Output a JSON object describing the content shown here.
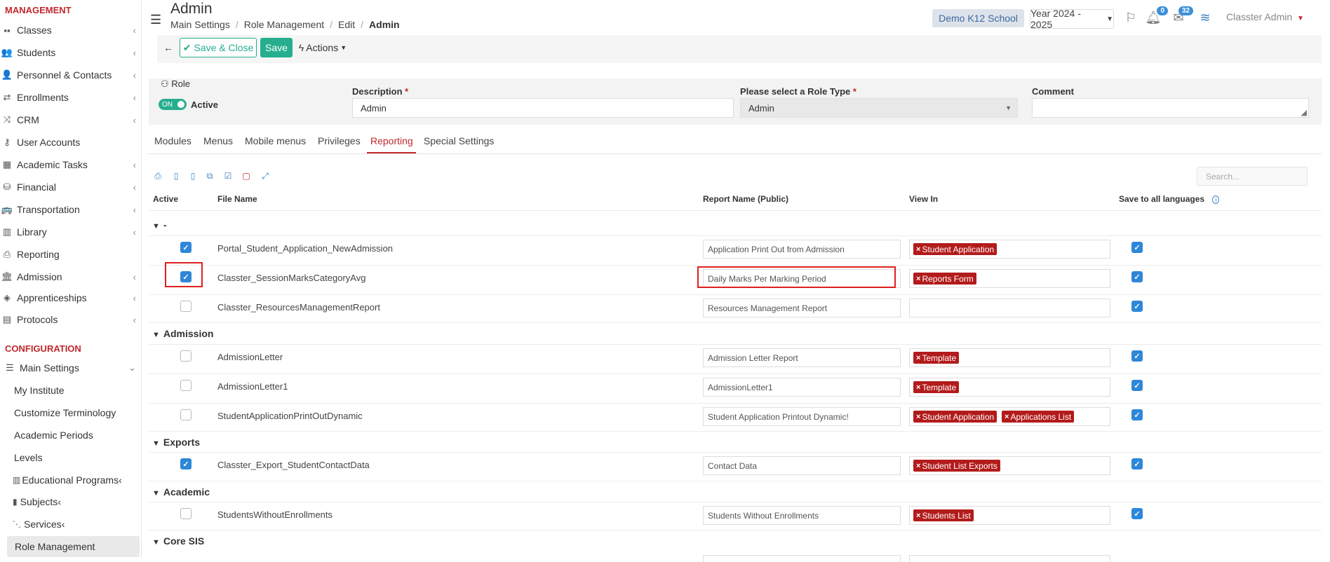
{
  "sidebar": {
    "management_title": "MANAGEMENT",
    "management_items": [
      {
        "label": "Classes",
        "icon": "classes-icon"
      },
      {
        "label": "Students",
        "icon": "students-icon"
      },
      {
        "label": "Personnel & Contacts",
        "icon": "person-icon"
      },
      {
        "label": "Enrollments",
        "icon": "swap-arrows-icon"
      },
      {
        "label": "CRM",
        "icon": "crm-icon"
      },
      {
        "label": "User Accounts",
        "icon": "key-icon"
      },
      {
        "label": "Academic Tasks",
        "icon": "grid-icon"
      },
      {
        "label": "Financial",
        "icon": "coins-icon"
      },
      {
        "label": "Transportation",
        "icon": "bus-icon"
      },
      {
        "label": "Library",
        "icon": "books-icon"
      },
      {
        "label": "Reporting",
        "icon": "printer-icon"
      },
      {
        "label": "Admission",
        "icon": "bank-icon"
      },
      {
        "label": "Apprenticeships",
        "icon": "box-icon"
      },
      {
        "label": "Protocols",
        "icon": "document-icon"
      }
    ],
    "configuration_title": "CONFIGURATION",
    "main_settings_label": "Main Settings",
    "sub_items": [
      "My Institute",
      "Customize Terminology",
      "Academic Periods",
      "Levels",
      "Educational Programs",
      "Subjects",
      "Services",
      "Role Management"
    ]
  },
  "header": {
    "title": "Admin",
    "breadcrumb": [
      "Main Settings",
      "Role Management",
      "Edit",
      "Admin"
    ],
    "school": "Demo K12 School",
    "year": "Year 2024 - 2025",
    "notifications_count": "0",
    "messages_count": "32",
    "user": "Classter Admin"
  },
  "toolbar": {
    "save_close": "Save & Close",
    "save": "Save",
    "actions": "Actions"
  },
  "role": {
    "section_label": "Role",
    "toggle_label": "ON",
    "active_label": "Active",
    "description_label": "Description",
    "description_value": "Admin",
    "role_type_label": "Please select a Role Type",
    "role_type_value": "Admin",
    "comment_label": "Comment",
    "comment_value": ""
  },
  "tabs": [
    "Modules",
    "Menus",
    "Mobile menus",
    "Privileges",
    "Reporting",
    "Special Settings"
  ],
  "grid": {
    "search_placeholder": "Search...",
    "headers": {
      "active": "Active",
      "file_name": "File Name",
      "report_name": "Report Name (Public)",
      "view_in": "View In",
      "save_all": "Save to all languages"
    },
    "groups": [
      {
        "name": "-",
        "rows": [
          {
            "active": true,
            "file": "Portal_Student_Application_NewAdmission",
            "report": "Application Print Out from Admission",
            "views": [
              "Student Application"
            ],
            "save_all": true
          },
          {
            "active": true,
            "file": "Classter_SessionMarksCategoryAvg",
            "report": "Daily Marks Per Marking Period",
            "views": [
              "Reports Form"
            ],
            "save_all": true
          },
          {
            "active": false,
            "file": "Classter_ResourcesManagementReport",
            "report": "Resources Management Report",
            "views": [],
            "save_all": true
          }
        ]
      },
      {
        "name": "Admission",
        "rows": [
          {
            "active": false,
            "file": "AdmissionLetter",
            "report": "Admission Letter Report",
            "views": [
              "Template"
            ],
            "save_all": true
          },
          {
            "active": false,
            "file": "AdmissionLetter1",
            "report": "AdmissionLetter1",
            "views": [
              "Template"
            ],
            "save_all": true
          },
          {
            "active": false,
            "file": "StudentApplicationPrintOutDynamic",
            "report": "Student Application Printout Dynamic!",
            "views": [
              "Student Application",
              "Applications List"
            ],
            "save_all": true
          }
        ]
      },
      {
        "name": "Exports",
        "rows": [
          {
            "active": true,
            "file": "Classter_Export_StudentContactData",
            "report": "Contact Data",
            "views": [
              "Student List Exports"
            ],
            "save_all": true
          }
        ]
      },
      {
        "name": "Academic",
        "rows": [
          {
            "active": false,
            "file": "StudentsWithoutEnrollments",
            "report": "Students Without Enrollments",
            "views": [
              "Students List"
            ],
            "save_all": true
          }
        ]
      },
      {
        "name": "Core SIS",
        "rows": []
      }
    ]
  },
  "colors": {
    "brand_red": "#c0282d",
    "primary_green": "#27ae8f",
    "checkbox_blue": "#2e87d7",
    "tag_red": "#b31b1b",
    "highlight_red": "#e02020"
  }
}
